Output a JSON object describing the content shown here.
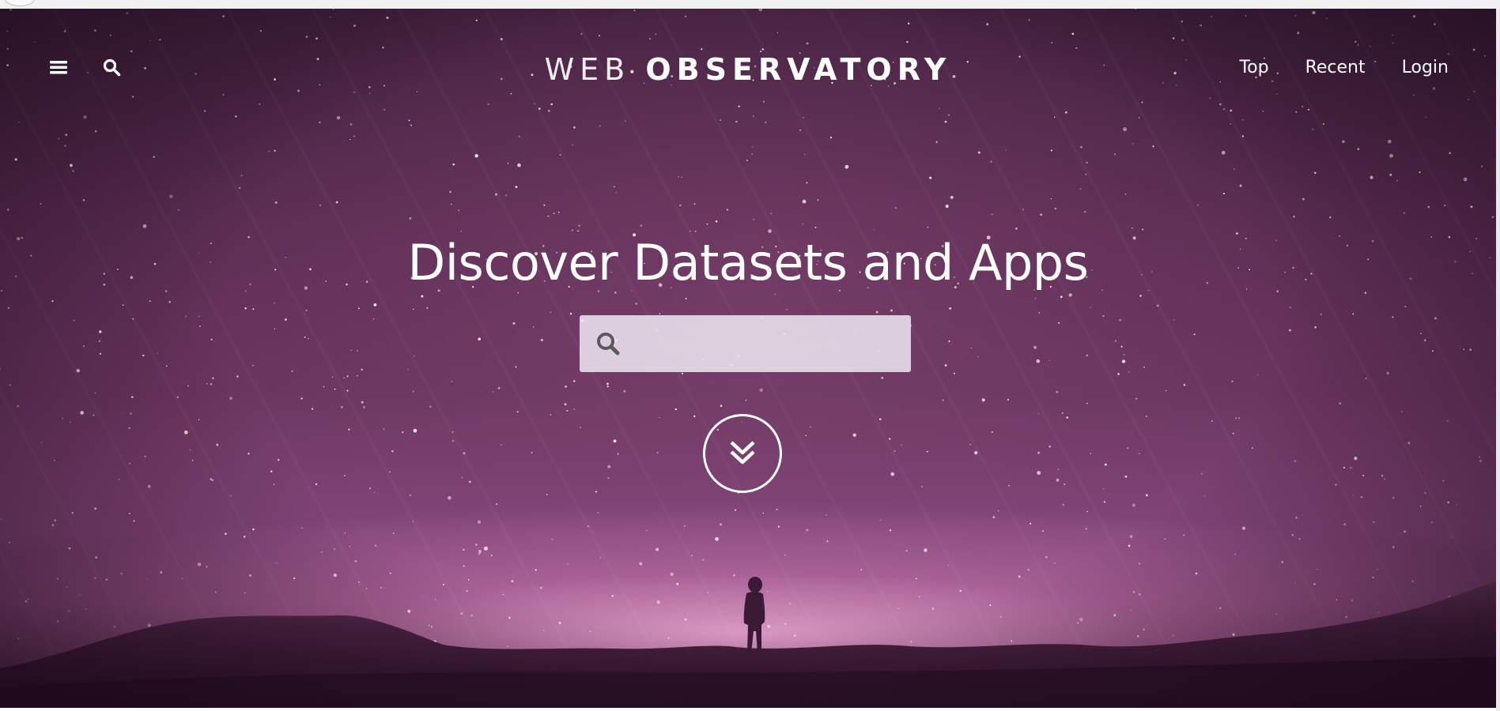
{
  "site_title": {
    "light": "WEB",
    "bold": "OBSERVATORY"
  },
  "nav": {
    "links": [
      "Top",
      "Recent",
      "Login"
    ]
  },
  "hero": {
    "headline": "Discover Datasets and Apps",
    "search_placeholder": ""
  },
  "icons": {
    "menu": "hamburger-menu-icon",
    "search": "search-icon",
    "search_box": "search-icon",
    "scroll_down": "double-chevron-down-icon"
  },
  "colors": {
    "sky_top": "#3e1e3a",
    "sky_mid": "#6a3560",
    "horizon_glow": "#eeaad7",
    "ground": "#2e1429",
    "text": "#ffffff",
    "search_box_bg": "#e8e0ea",
    "search_icon": "#5a5a5a"
  }
}
